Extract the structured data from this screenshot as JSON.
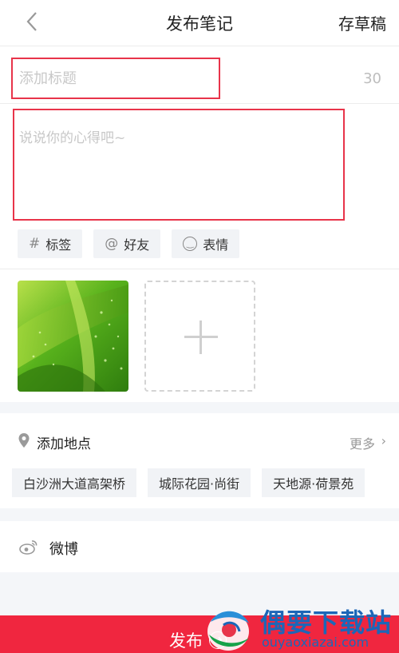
{
  "header": {
    "back_icon": "chevron-left-icon",
    "title": "发布笔记",
    "draft_label": "存草稿"
  },
  "note": {
    "title_placeholder": "添加标题",
    "title_max_chars": "30",
    "body_placeholder": "说说你的心得吧~"
  },
  "tools": [
    {
      "icon": "hashtag-icon",
      "glyph": "#",
      "label": "标签"
    },
    {
      "icon": "at-icon",
      "glyph": "@",
      "label": "好友"
    },
    {
      "icon": "smile-icon",
      "glyph": "☺",
      "label": "表情"
    }
  ],
  "photos": {
    "thumbnail": "green-leaf-photo",
    "add_icon": "plus-icon"
  },
  "location": {
    "title": "添加地点",
    "more_label": "更多",
    "more_icon": "chevron-right-icon",
    "suggestions": [
      "白沙洲大道高架桥",
      "城际花园·尚街",
      "天地源·荷景苑"
    ]
  },
  "share": {
    "icon": "weibo-icon",
    "label": "微博"
  },
  "publish": {
    "label": "发布"
  },
  "watermark": {
    "title": "偶要下载站",
    "url": "ouyaoxiazai.com"
  },
  "colors": {
    "accent": "#f0263f",
    "highlight_border": "#e8344a",
    "placeholder": "#c8c8c8",
    "chip_bg": "#f1f3f6",
    "watermark_blue": "#1c67b8"
  }
}
